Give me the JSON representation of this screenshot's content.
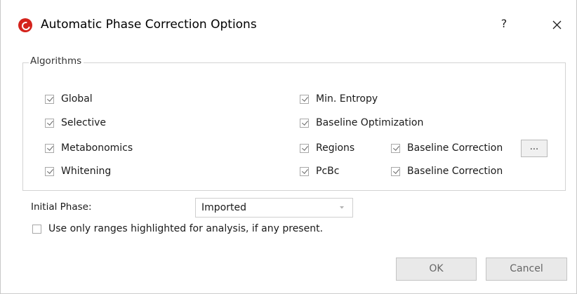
{
  "window": {
    "title": "Automatic Phase Correction Options",
    "help_label": "?",
    "close_icon": "close-icon",
    "app_icon": "app-logo-icon",
    "brand_color": "#d4231c"
  },
  "algorithms": {
    "legend": "Algorithms",
    "left_column": [
      {
        "label": "Global",
        "checked": true
      },
      {
        "label": "Selective",
        "checked": true
      },
      {
        "label": "Metabonomics",
        "checked": true
      },
      {
        "label": "Whitening",
        "checked": true
      }
    ],
    "right_column": [
      {
        "label": "Min. Entropy",
        "checked": true
      },
      {
        "label": "Baseline Optimization",
        "checked": true
      },
      {
        "label": "Regions",
        "checked": true
      },
      {
        "label": "PcBc",
        "checked": true
      }
    ],
    "regions_baseline": {
      "label": "Baseline Correction",
      "checked": true
    },
    "pcbc_baseline": {
      "label": "Baseline Correction",
      "checked": true
    },
    "more_button_label": "..."
  },
  "initial_phase": {
    "label": "Initial Phase:",
    "value": "Imported",
    "arrow_icon": "dropdown-arrow-icon"
  },
  "use_ranges": {
    "label": "Use only ranges highlighted for analysis, if any present.",
    "checked": false
  },
  "buttons": {
    "ok": "OK",
    "cancel": "Cancel"
  }
}
